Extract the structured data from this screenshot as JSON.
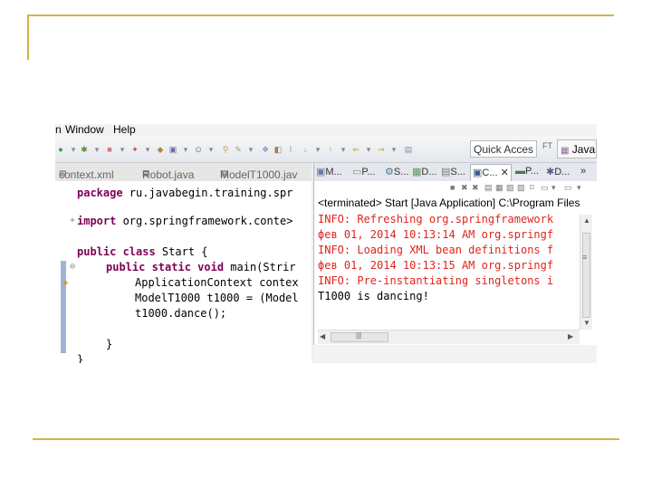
{
  "menubar": {
    "partial_left": "n",
    "window": "Window",
    "help": "Help"
  },
  "toolbar": {
    "quick_access": "Quick Acces",
    "shortcut_hint": "FT",
    "perspective_label": "Java"
  },
  "editor": {
    "tabs": [
      "context.xml",
      "Robot.java",
      "ModelT1000.jav"
    ],
    "lines": [
      {
        "kw": "package",
        "text": " ru.javabegin.training.spr"
      },
      {
        "kw": "import",
        "text": " org.springframework.conte>"
      },
      {
        "kw": "public class",
        "text": " Start {"
      },
      {
        "kw": "public static void",
        "text": " main(Strir"
      },
      {
        "kw": "",
        "text": "ApplicationContext contex"
      },
      {
        "kw": "",
        "text": "ModelT1000 t1000 = (Model"
      },
      {
        "kw": "",
        "text": "t1000.dance();"
      },
      {
        "kw": "",
        "text": "}"
      },
      {
        "kw": "",
        "text": "}"
      }
    ]
  },
  "views": {
    "tabs": [
      "M...",
      "P...",
      "S...",
      "D...",
      "S...",
      "C...",
      "P...",
      "D..."
    ],
    "overflow": "»"
  },
  "console": {
    "terminated": "<terminated> Start [Java Application] C:\\Program Files",
    "lines": [
      {
        "text": "INFO: Refreshing org.springframework",
        "color": "#e0241b"
      },
      {
        "text": "фев 01, 2014 10:13:14 AM org.springf",
        "color": "#e0241b"
      },
      {
        "text": "INFO: Loading XML bean definitions f",
        "color": "#e0241b"
      },
      {
        "text": "фев 01, 2014 10:13:15 AM org.springf",
        "color": "#e0241b"
      },
      {
        "text": "INFO: Pre-instantiating singletons i",
        "color": "#e0241b"
      },
      {
        "text": "T1000 is dancing!",
        "color": "#000000"
      }
    ]
  },
  "colors": {
    "accent_line": "#d6b24a",
    "error_red": "#e0241b",
    "keyword": "#7f0055"
  }
}
